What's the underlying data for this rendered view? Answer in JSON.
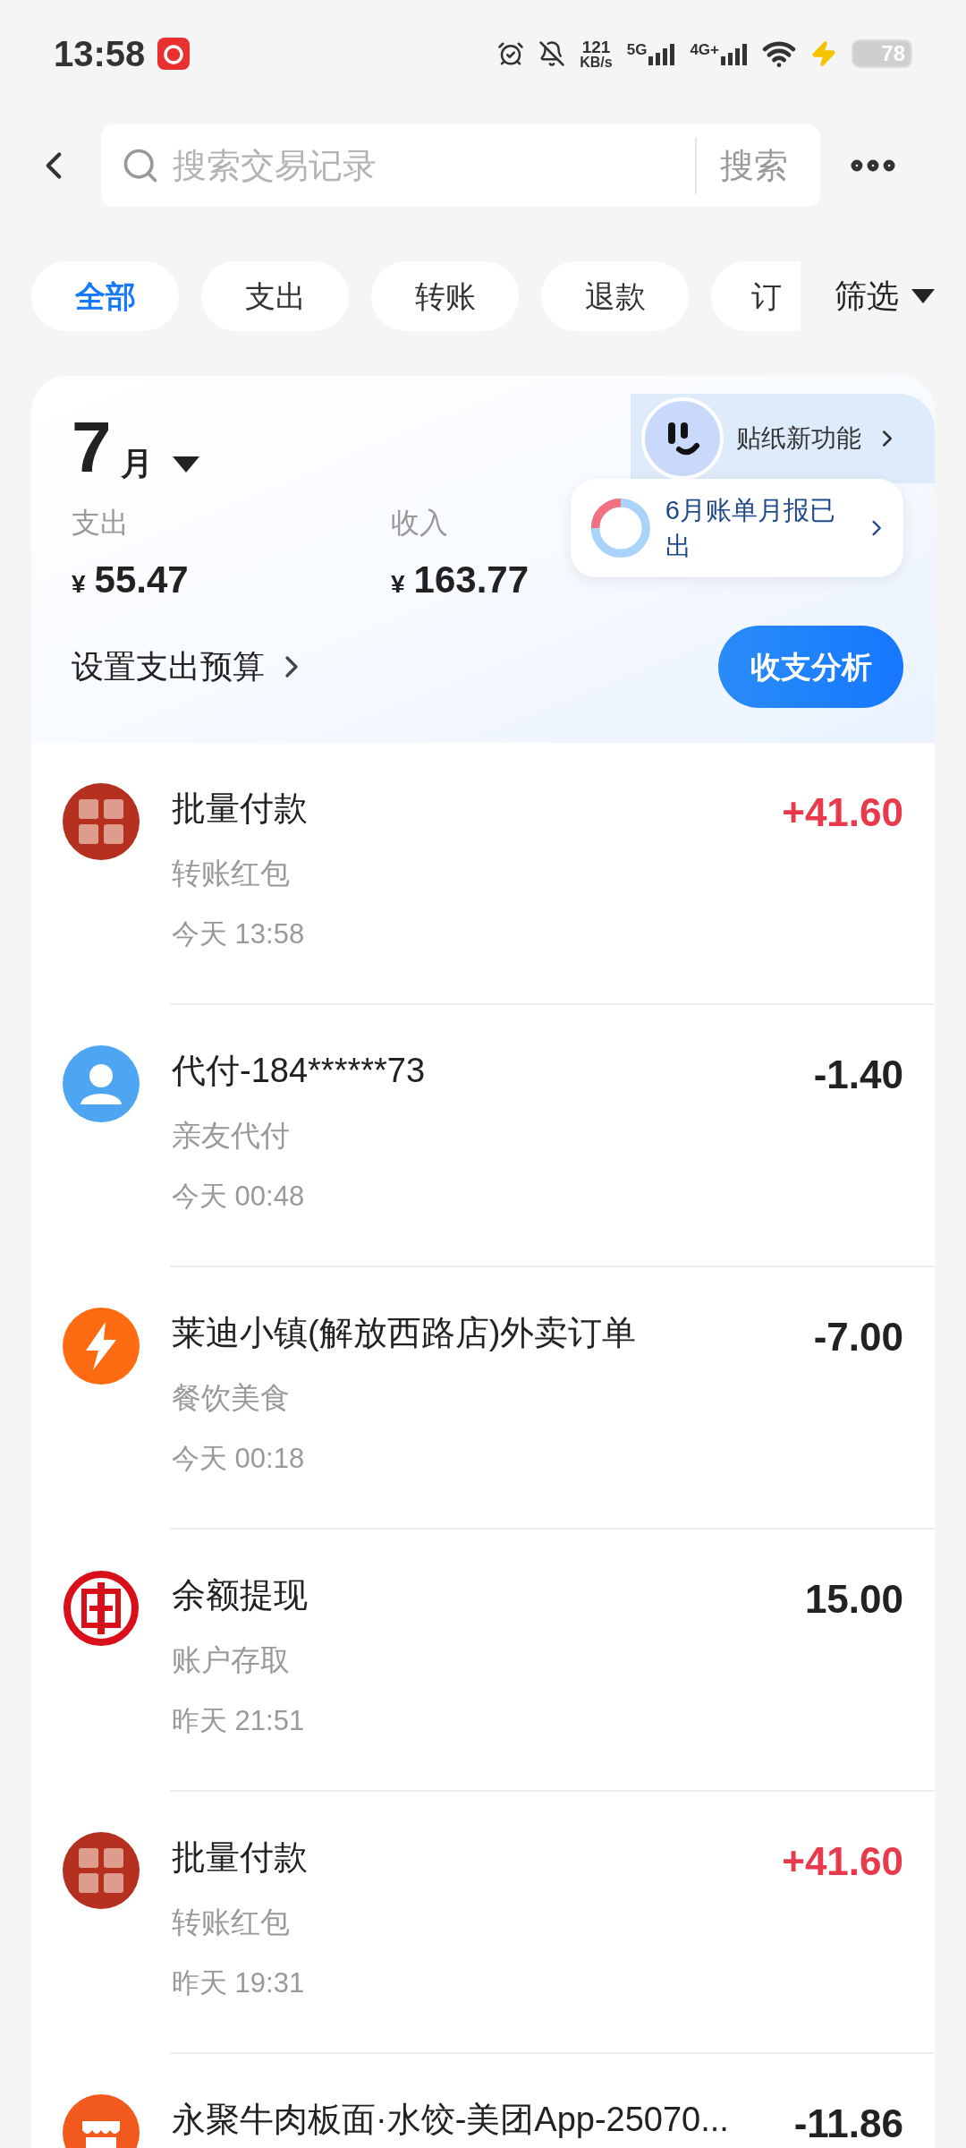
{
  "status_bar": {
    "time": "13:58",
    "net_speed_value": "121",
    "net_speed_unit": "KB/s",
    "signals": [
      "5G",
      "4G+"
    ],
    "battery": "78"
  },
  "search": {
    "placeholder": "搜索交易记录",
    "button": "搜索"
  },
  "filters": [
    {
      "label": "全部",
      "selected": true
    },
    {
      "label": "支出",
      "selected": false
    },
    {
      "label": "转账",
      "selected": false
    },
    {
      "label": "退款",
      "selected": false
    },
    {
      "label": "订",
      "selected": false
    }
  ],
  "filter_button": "筛选",
  "summary": {
    "month_number": "7",
    "month_unit": "月",
    "expense_label": "支出",
    "expense_currency": "¥",
    "expense": "55.47",
    "income_label": "收入",
    "income_currency": "¥",
    "income": "163.77",
    "budget_link": "设置支出预算",
    "sticker_promo": "贴纸新功能",
    "report_tip": "6月账单月报已出",
    "analysis_button": "收支分析"
  },
  "transactions": [
    {
      "kind": "seal",
      "title": "批量付款",
      "category": "转账红包",
      "time": "今天 13:58",
      "amount": "+41.60",
      "income": true
    },
    {
      "kind": "person",
      "title": "代付-184******73",
      "category": "亲友代付",
      "time": "今天 00:48",
      "amount": "-1.40",
      "income": false
    },
    {
      "kind": "flash",
      "title": "莱迪小镇(解放西路店)外卖订单",
      "category": "餐饮美食",
      "time": "今天 00:18",
      "amount": "-7.00",
      "income": false
    },
    {
      "kind": "bank",
      "title": "余额提现",
      "category": "账户存取",
      "time": "昨天 21:51",
      "amount": "15.00",
      "income": false
    },
    {
      "kind": "seal",
      "title": "批量付款",
      "category": "转账红包",
      "time": "昨天 19:31",
      "amount": "+41.60",
      "income": true
    },
    {
      "kind": "shop",
      "title": "永聚牛肉板面·水饺-美团App-25070...",
      "amount": "-11.86",
      "income": false
    }
  ]
}
